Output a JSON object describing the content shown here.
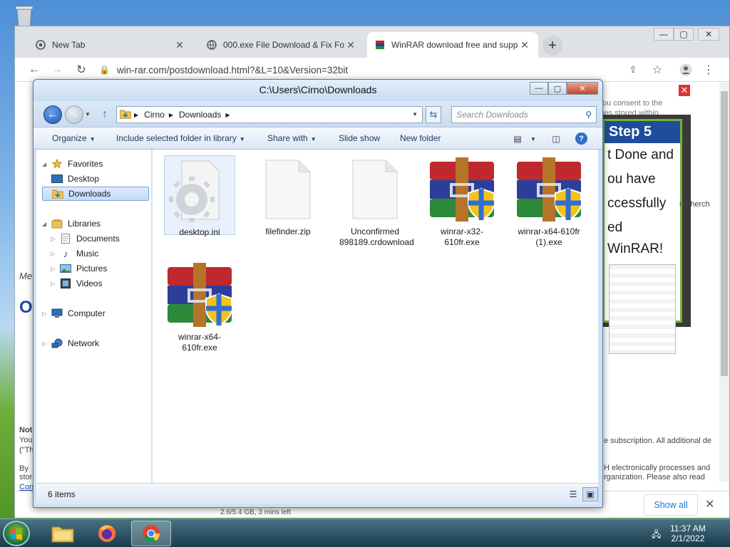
{
  "browser": {
    "tabs": [
      {
        "label": "New Tab"
      },
      {
        "label": "000.exe File Download & Fix For"
      },
      {
        "label": "WinRAR download free and supp"
      }
    ],
    "url": "win-rar.com/postdownload.html?&L=10&Version=32bit"
  },
  "page": {
    "consent_text": "ou consent to the ies stored within",
    "ad": {
      "step": "Step 5",
      "lines": [
        "t Done and",
        "ou have",
        "ccessfully",
        "ed WinRAR!"
      ]
    },
    "search_partial": "recherch",
    "left_fragments": [
      "Me",
      "O",
      "Note",
      "You",
      "(\"Th",
      "By",
      "stor",
      "Con"
    ],
    "right_lines": [
      "e subscription. All additional de",
      "H electronically processes and",
      "rganization. Please also read"
    ],
    "download_bar": {
      "item_meta": "2.6/5.4 GB, 3 mins left",
      "show_all": "Show all"
    }
  },
  "explorer": {
    "title": "C:\\Users\\Cirno\\Downloads",
    "breadcrumb": [
      "Cirno",
      "Downloads"
    ],
    "search_placeholder": "Search Downloads",
    "commands": {
      "organize": "Organize",
      "include": "Include selected folder in library",
      "share": "Share with",
      "slideshow": "Slide show",
      "newfolder": "New folder"
    },
    "nav": {
      "favorites": "Favorites",
      "desktop": "Desktop",
      "downloads": "Downloads",
      "libraries": "Libraries",
      "documents": "Documents",
      "music": "Music",
      "pictures": "Pictures",
      "videos": "Videos",
      "computer": "Computer",
      "network": "Network"
    },
    "files": [
      {
        "name": "desktop.ini",
        "icon": "settings-file-icon"
      },
      {
        "name": "filefinder.zip",
        "icon": "blank-file-icon"
      },
      {
        "name": "Unconfirmed 898189.crdownload",
        "icon": "blank-file-icon"
      },
      {
        "name": "winrar-x32-610fr.exe",
        "icon": "winrar-installer-icon"
      },
      {
        "name": "winrar-x64-610fr (1).exe",
        "icon": "winrar-installer-icon"
      },
      {
        "name": "winrar-x64-610fr.exe",
        "icon": "winrar-installer-icon"
      }
    ],
    "status": "6 items"
  },
  "taskbar": {
    "time": "11:37 AM",
    "date": "2/1/2022"
  },
  "colors": {
    "ad_header": "#1f4c9b",
    "ad_border": "#73b430",
    "explorer_frame": "#cfe0f2",
    "link_blue": "#1a73e8"
  }
}
